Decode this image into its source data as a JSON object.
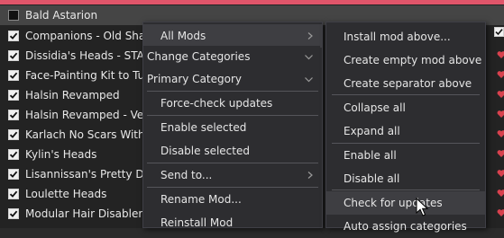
{
  "mod_list": {
    "rows": [
      {
        "label": "Bald Astarion",
        "checked": false
      },
      {
        "label": "Companions - Old Shad",
        "checked": true
      },
      {
        "label": "Dissidia's Heads - STAND",
        "checked": true
      },
      {
        "label": "Face-Painting Kit to Tuto",
        "checked": true
      },
      {
        "label": "Halsin Revamped",
        "checked": true
      },
      {
        "label": "Halsin Revamped - Vess",
        "checked": true
      },
      {
        "label": "Karlach No Scars With G",
        "checked": true
      },
      {
        "label": "Kylin's Heads",
        "checked": true
      },
      {
        "label": "Lisannissan's Pretty Dice",
        "checked": true
      },
      {
        "label": "Loulette Heads",
        "checked": true
      },
      {
        "label": "Modular Hair Disabler -",
        "checked": true
      }
    ]
  },
  "context_menu": {
    "all_mods": "All Mods",
    "change_categories": "Change Categories",
    "primary_category": "Primary Category",
    "force_check_updates": "Force-check updates",
    "enable_selected": "Enable selected",
    "disable_selected": "Disable selected",
    "send_to": "Send to...",
    "rename_mod": "Rename Mod...",
    "reinstall_mod": "Reinstall Mod"
  },
  "submenu": {
    "install_mod_above": "Install mod above...",
    "create_empty_mod_above": "Create empty mod above",
    "create_separator_above": "Create separator above",
    "collapse_all": "Collapse all",
    "expand_all": "Expand all",
    "enable_all": "Enable all",
    "disable_all": "Disable all",
    "check_for_updates": "Check for updates",
    "auto_assign_categories": "Auto assign categories"
  },
  "icons": {
    "checkbox": "checkbox-checked-icon",
    "heart": "heart-icon",
    "arrow": "chevron-right-icon",
    "dropdown": "chevron-down-icon",
    "cursor": "mouse-pointer-icon"
  },
  "colors": {
    "accent_bar": "#e0556a",
    "heart": "#d9414e",
    "menu_bg": "#2d2d30",
    "highlight": "#3e3e42"
  }
}
